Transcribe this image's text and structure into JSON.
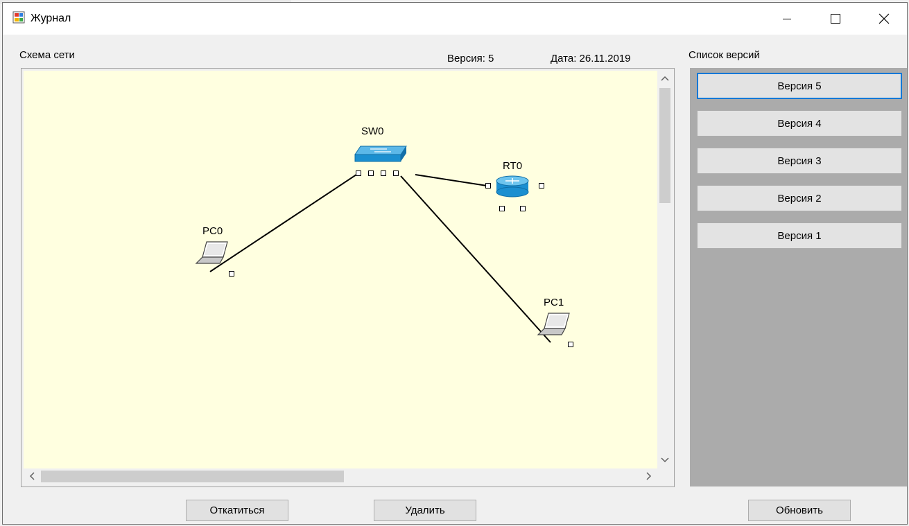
{
  "window": {
    "title": "Журнал"
  },
  "diagram": {
    "label": "Схема сети",
    "version_text": "Версия: 5",
    "date_text": "Дата: 26.11.2019",
    "background": "#ffffe0",
    "nodes": {
      "sw0": "SW0",
      "rt0": "RT0",
      "pc0": "PC0",
      "pc1": "PC1"
    }
  },
  "versions": {
    "label": "Список версий",
    "items": [
      "Версия 5",
      "Версия 4",
      "Версия 3",
      "Версия 2",
      "Версия 1"
    ],
    "selected": "Версия 5"
  },
  "buttons": {
    "rollback": "Откатиться",
    "delete": "Удалить",
    "refresh": "Обновить"
  },
  "colors": {
    "accent": "#0078d7",
    "device_blue": "#1b8fd0"
  },
  "icons": [
    "app-icon",
    "minimize-icon",
    "maximize-icon",
    "close-icon",
    "switch-icon",
    "router-icon",
    "laptop-icon",
    "chevron-up-icon",
    "chevron-down-icon",
    "chevron-left-icon",
    "chevron-right-icon"
  ]
}
